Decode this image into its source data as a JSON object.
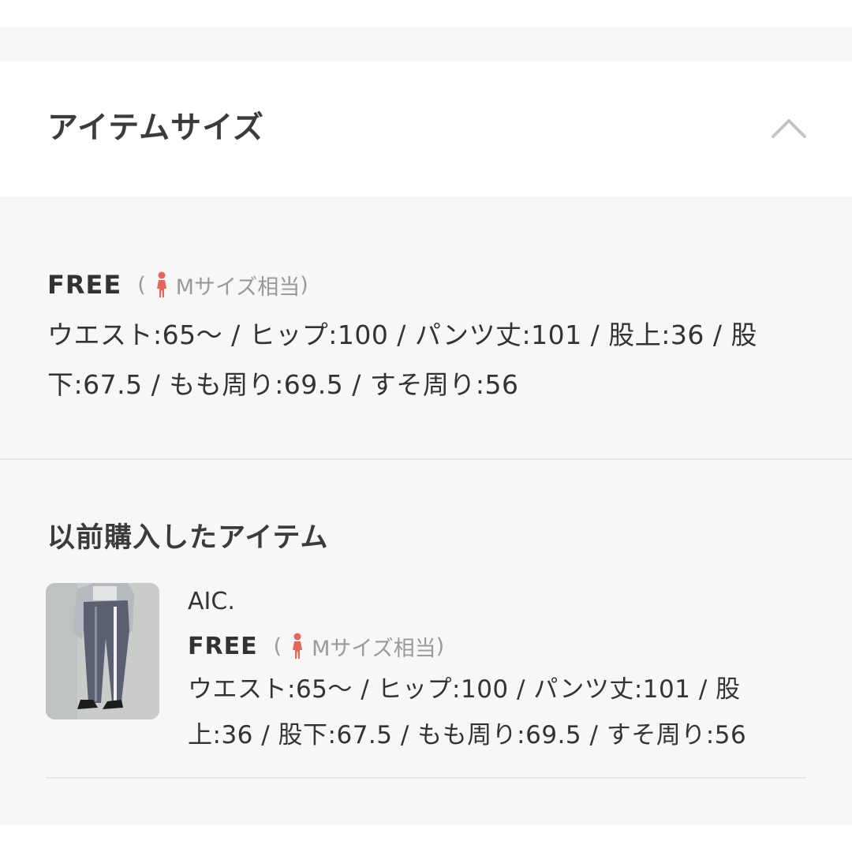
{
  "section": {
    "title": "アイテムサイズ"
  },
  "size_info": {
    "size_name": "FREE",
    "open_paren": "(",
    "equivalent": "Mサイズ相当",
    "close_paren": ")",
    "measurements": "ウエスト:65～ / ヒップ:100 / パンツ丈:101 / 股上:36 / 股下:67.5 / もも周り:69.5 / すそ周り:56",
    "icon": "woman-icon",
    "icon_color": "#e2675c"
  },
  "previous": {
    "title": "以前購入したアイテム",
    "items": [
      {
        "brand": "AIC.",
        "size_name": "FREE",
        "open_paren": "(",
        "equivalent": "Mサイズ相当",
        "close_paren": ")",
        "measurements": "ウエスト:65～ / ヒップ:100 / パンツ丈:101 / 股上:36 / 股下:67.5 / もも周り:69.5 / すそ周り:56"
      }
    ]
  }
}
